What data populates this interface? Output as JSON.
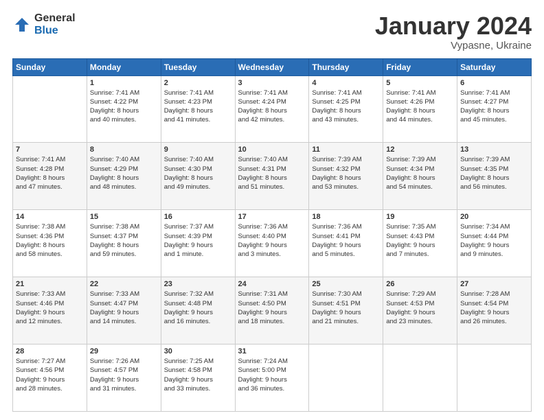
{
  "header": {
    "logo": {
      "general": "General",
      "blue": "Blue"
    },
    "title": "January 2024",
    "location": "Vypasne, Ukraine"
  },
  "calendar": {
    "days": [
      "Sunday",
      "Monday",
      "Tuesday",
      "Wednesday",
      "Thursday",
      "Friday",
      "Saturday"
    ],
    "weeks": [
      [
        {
          "day": "",
          "info": ""
        },
        {
          "day": "1",
          "info": "Sunrise: 7:41 AM\nSunset: 4:22 PM\nDaylight: 8 hours\nand 40 minutes."
        },
        {
          "day": "2",
          "info": "Sunrise: 7:41 AM\nSunset: 4:23 PM\nDaylight: 8 hours\nand 41 minutes."
        },
        {
          "day": "3",
          "info": "Sunrise: 7:41 AM\nSunset: 4:24 PM\nDaylight: 8 hours\nand 42 minutes."
        },
        {
          "day": "4",
          "info": "Sunrise: 7:41 AM\nSunset: 4:25 PM\nDaylight: 8 hours\nand 43 minutes."
        },
        {
          "day": "5",
          "info": "Sunrise: 7:41 AM\nSunset: 4:26 PM\nDaylight: 8 hours\nand 44 minutes."
        },
        {
          "day": "6",
          "info": "Sunrise: 7:41 AM\nSunset: 4:27 PM\nDaylight: 8 hours\nand 45 minutes."
        }
      ],
      [
        {
          "day": "7",
          "info": "Sunrise: 7:41 AM\nSunset: 4:28 PM\nDaylight: 8 hours\nand 47 minutes."
        },
        {
          "day": "8",
          "info": "Sunrise: 7:40 AM\nSunset: 4:29 PM\nDaylight: 8 hours\nand 48 minutes."
        },
        {
          "day": "9",
          "info": "Sunrise: 7:40 AM\nSunset: 4:30 PM\nDaylight: 8 hours\nand 49 minutes."
        },
        {
          "day": "10",
          "info": "Sunrise: 7:40 AM\nSunset: 4:31 PM\nDaylight: 8 hours\nand 51 minutes."
        },
        {
          "day": "11",
          "info": "Sunrise: 7:39 AM\nSunset: 4:32 PM\nDaylight: 8 hours\nand 53 minutes."
        },
        {
          "day": "12",
          "info": "Sunrise: 7:39 AM\nSunset: 4:34 PM\nDaylight: 8 hours\nand 54 minutes."
        },
        {
          "day": "13",
          "info": "Sunrise: 7:39 AM\nSunset: 4:35 PM\nDaylight: 8 hours\nand 56 minutes."
        }
      ],
      [
        {
          "day": "14",
          "info": "Sunrise: 7:38 AM\nSunset: 4:36 PM\nDaylight: 8 hours\nand 58 minutes."
        },
        {
          "day": "15",
          "info": "Sunrise: 7:38 AM\nSunset: 4:37 PM\nDaylight: 8 hours\nand 59 minutes."
        },
        {
          "day": "16",
          "info": "Sunrise: 7:37 AM\nSunset: 4:39 PM\nDaylight: 9 hours\nand 1 minute."
        },
        {
          "day": "17",
          "info": "Sunrise: 7:36 AM\nSunset: 4:40 PM\nDaylight: 9 hours\nand 3 minutes."
        },
        {
          "day": "18",
          "info": "Sunrise: 7:36 AM\nSunset: 4:41 PM\nDaylight: 9 hours\nand 5 minutes."
        },
        {
          "day": "19",
          "info": "Sunrise: 7:35 AM\nSunset: 4:43 PM\nDaylight: 9 hours\nand 7 minutes."
        },
        {
          "day": "20",
          "info": "Sunrise: 7:34 AM\nSunset: 4:44 PM\nDaylight: 9 hours\nand 9 minutes."
        }
      ],
      [
        {
          "day": "21",
          "info": "Sunrise: 7:33 AM\nSunset: 4:46 PM\nDaylight: 9 hours\nand 12 minutes."
        },
        {
          "day": "22",
          "info": "Sunrise: 7:33 AM\nSunset: 4:47 PM\nDaylight: 9 hours\nand 14 minutes."
        },
        {
          "day": "23",
          "info": "Sunrise: 7:32 AM\nSunset: 4:48 PM\nDaylight: 9 hours\nand 16 minutes."
        },
        {
          "day": "24",
          "info": "Sunrise: 7:31 AM\nSunset: 4:50 PM\nDaylight: 9 hours\nand 18 minutes."
        },
        {
          "day": "25",
          "info": "Sunrise: 7:30 AM\nSunset: 4:51 PM\nDaylight: 9 hours\nand 21 minutes."
        },
        {
          "day": "26",
          "info": "Sunrise: 7:29 AM\nSunset: 4:53 PM\nDaylight: 9 hours\nand 23 minutes."
        },
        {
          "day": "27",
          "info": "Sunrise: 7:28 AM\nSunset: 4:54 PM\nDaylight: 9 hours\nand 26 minutes."
        }
      ],
      [
        {
          "day": "28",
          "info": "Sunrise: 7:27 AM\nSunset: 4:56 PM\nDaylight: 9 hours\nand 28 minutes."
        },
        {
          "day": "29",
          "info": "Sunrise: 7:26 AM\nSunset: 4:57 PM\nDaylight: 9 hours\nand 31 minutes."
        },
        {
          "day": "30",
          "info": "Sunrise: 7:25 AM\nSunset: 4:58 PM\nDaylight: 9 hours\nand 33 minutes."
        },
        {
          "day": "31",
          "info": "Sunrise: 7:24 AM\nSunset: 5:00 PM\nDaylight: 9 hours\nand 36 minutes."
        },
        {
          "day": "",
          "info": ""
        },
        {
          "day": "",
          "info": ""
        },
        {
          "day": "",
          "info": ""
        }
      ]
    ]
  }
}
